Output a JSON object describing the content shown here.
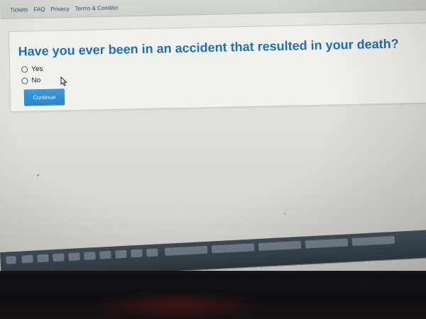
{
  "nav": {
    "links": [
      "Tickets",
      "FAQ",
      "Privacy",
      "Terms & Conditio"
    ]
  },
  "form": {
    "question": "Have you ever been in an accident that resulted in your death?",
    "options": [
      "Yes",
      "No"
    ],
    "selected": null,
    "continue_label": "Continue"
  },
  "colors": {
    "question_text": "#1f6fb8",
    "button_bg": "#2a86c7",
    "nav_link": "#2e4f7a"
  },
  "icons": {
    "pointer": "mouse-pointer-icon"
  }
}
